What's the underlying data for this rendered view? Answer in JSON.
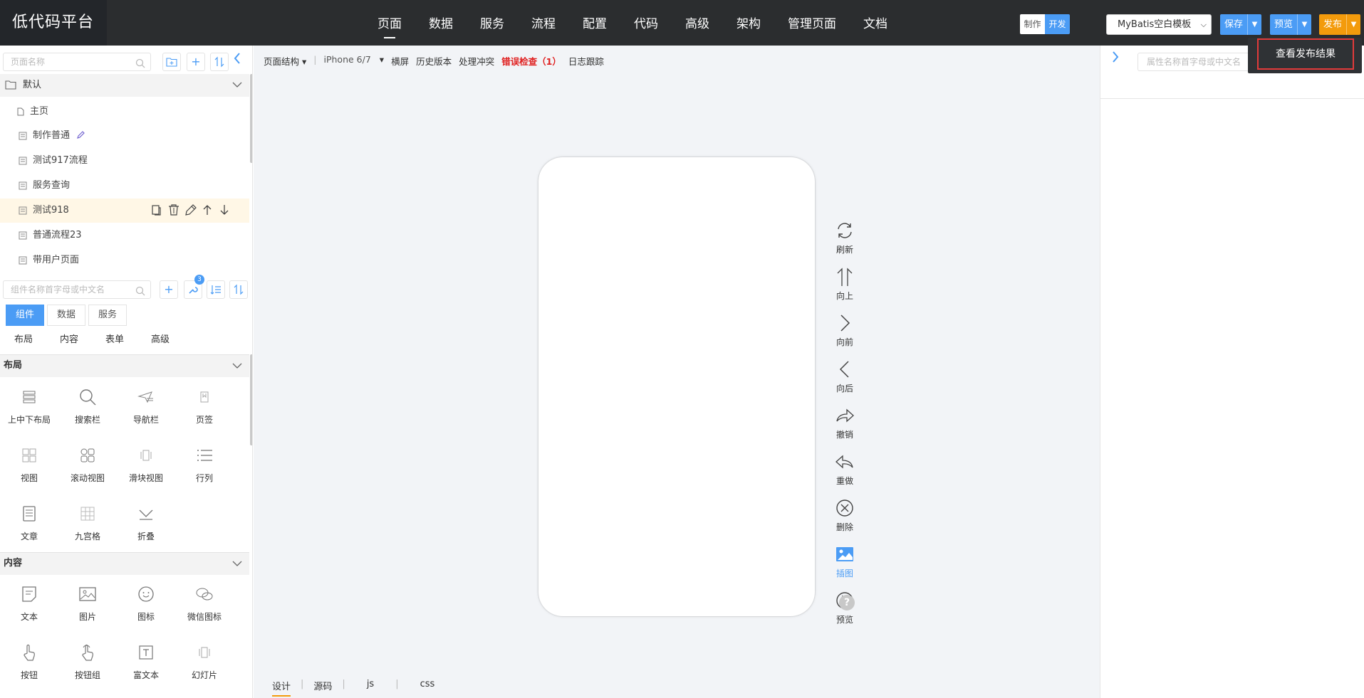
{
  "app": {
    "title": "低代码平台"
  },
  "nav": [
    {
      "label": "页面",
      "active": true
    },
    {
      "label": "数据"
    },
    {
      "label": "服务"
    },
    {
      "label": "流程"
    },
    {
      "label": "配置"
    },
    {
      "label": "代码"
    },
    {
      "label": "高级"
    },
    {
      "label": "架构"
    },
    {
      "label": "管理页面"
    },
    {
      "label": "文档"
    }
  ],
  "mode": {
    "make": "制作",
    "dev": "开发",
    "active": "开发"
  },
  "template_select": {
    "value": "MyBatis空白模板"
  },
  "buttons": {
    "save": "保存",
    "preview": "预览",
    "publish": "发布"
  },
  "publish_menu": {
    "item": "查看发布结果"
  },
  "left": {
    "page_search_placeholder": "页面名称",
    "group": {
      "label": "默认"
    },
    "home": "主页",
    "pages": [
      "制作普通",
      "测试917流程",
      "服务查询",
      "测试918",
      "普通流程23",
      "带用户页面"
    ],
    "selected_page": "测试918",
    "component_search_placeholder": "组件名称首字母或中文名",
    "badge": "3",
    "tabs": [
      "组件",
      "数据",
      "服务"
    ],
    "active_tab": "组件",
    "subtabs": [
      "布局",
      "内容",
      "表单",
      "高级"
    ],
    "sections": [
      {
        "title": "布局",
        "items": [
          {
            "label": "上中下布局",
            "icon": "layers-icon"
          },
          {
            "label": "搜索栏",
            "icon": "search-icon"
          },
          {
            "label": "导航栏",
            "icon": "navbar-icon"
          },
          {
            "label": "页签",
            "icon": "bookmark-icon"
          },
          {
            "label": "视图",
            "icon": "view-icon"
          },
          {
            "label": "滚动视图",
            "icon": "grid-icon"
          },
          {
            "label": "滑块视图",
            "icon": "slider-icon"
          },
          {
            "label": "行列",
            "icon": "list-icon"
          },
          {
            "label": "文章",
            "icon": "article-icon"
          },
          {
            "label": "九宫格",
            "icon": "nine-grid-icon"
          },
          {
            "label": "折叠",
            "icon": "fold-icon"
          }
        ]
      },
      {
        "title": "内容",
        "items": [
          {
            "label": "文本",
            "icon": "text-icon"
          },
          {
            "label": "图片",
            "icon": "image-icon"
          },
          {
            "label": "图标",
            "icon": "smile-icon"
          },
          {
            "label": "微信图标",
            "icon": "wechat-icon"
          },
          {
            "label": "按钮",
            "icon": "finger-icon"
          },
          {
            "label": "按钮组",
            "icon": "finger-group-icon"
          },
          {
            "label": "富文本",
            "icon": "rich-text-icon"
          },
          {
            "label": "幻灯片",
            "icon": "slides-icon"
          }
        ]
      }
    ]
  },
  "canvas": {
    "toolbar": {
      "structure": "页面结构",
      "device": "iPhone 6/7",
      "landscape": "横屏",
      "history": "历史版本",
      "conflict": "处理冲突",
      "error_check": "错误检查（1）",
      "log": "日志跟踪"
    },
    "side_tools": [
      {
        "label": "刷新",
        "icon": "refresh-icon"
      },
      {
        "label": "向上",
        "icon": "up-icon"
      },
      {
        "label": "向前",
        "icon": "forward-icon"
      },
      {
        "label": "向后",
        "icon": "back-icon"
      },
      {
        "label": "撤销",
        "icon": "undo-icon"
      },
      {
        "label": "重做",
        "icon": "redo-icon"
      },
      {
        "label": "删除",
        "icon": "delete-icon"
      },
      {
        "label": "插图",
        "icon": "insert-image-icon",
        "active": true
      },
      {
        "label": "预览",
        "icon": "play-icon"
      }
    ],
    "help": "?",
    "bottom_tabs": [
      "设计",
      "源码",
      "js",
      "css"
    ],
    "active_bottom_tab": "设计"
  },
  "right": {
    "prop_search_placeholder": "属性名称首字母或中文名"
  },
  "colors": {
    "topbar": "#2b2d2f",
    "accent": "#4b9cf5",
    "publish": "#f39b0c",
    "error": "#e02020",
    "highlight_border": "#e23b3b"
  }
}
